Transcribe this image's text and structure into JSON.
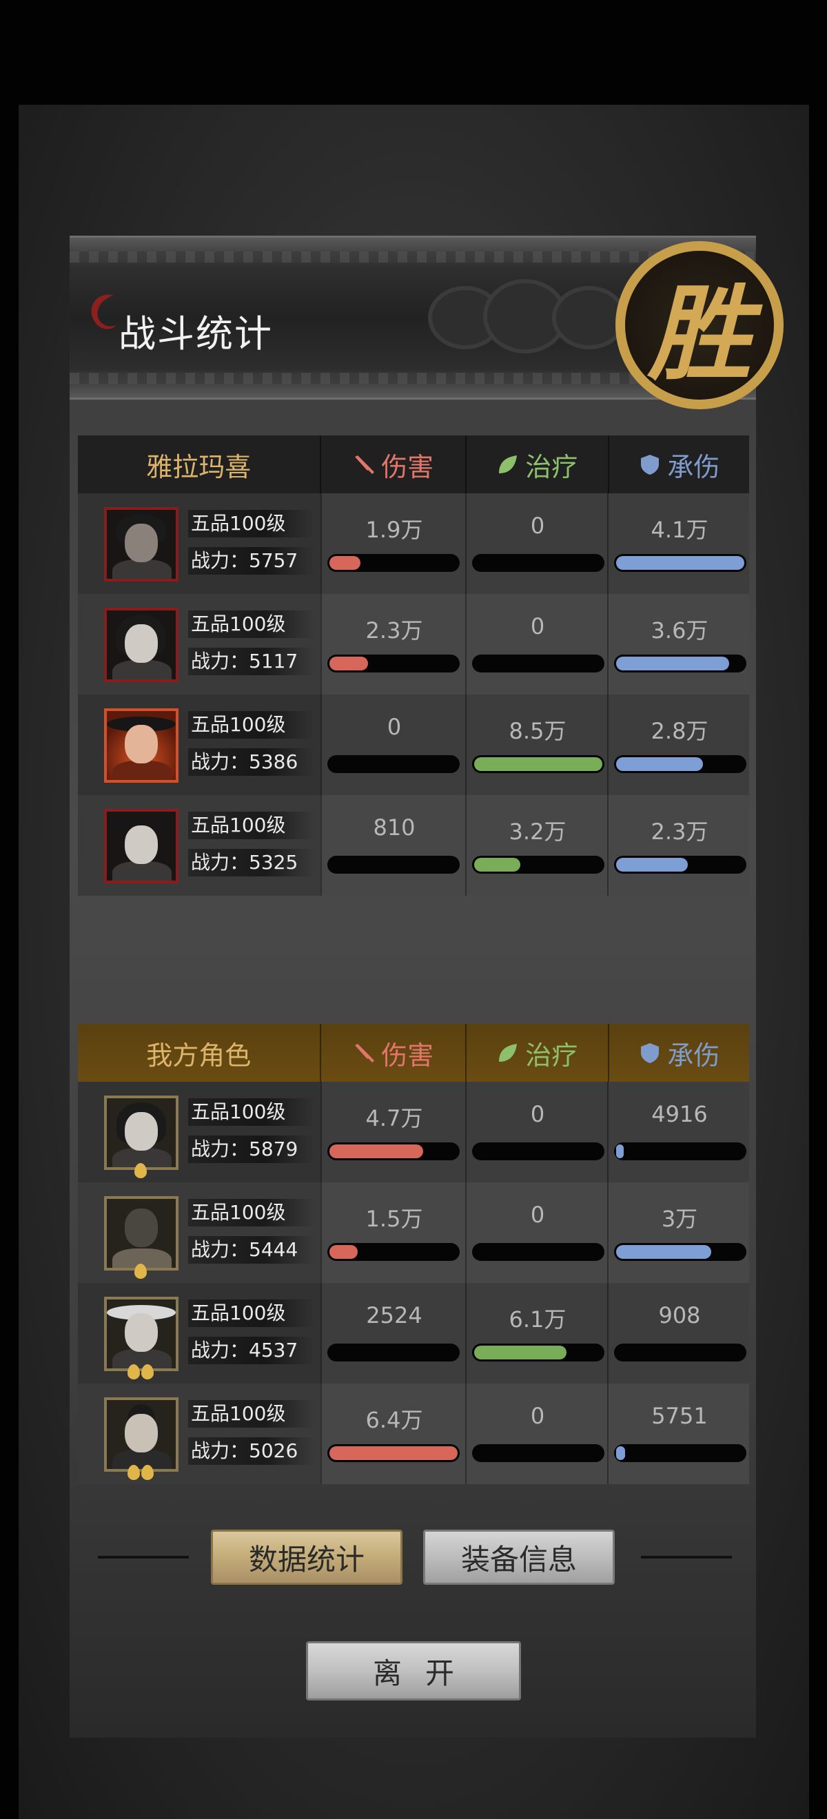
{
  "header": {
    "title": "战斗统计",
    "result_seal": "胜"
  },
  "columns": {
    "damage": "伤害",
    "healing": "治疗",
    "tanked": "承伤"
  },
  "enemy_team": {
    "name": "雅拉玛喜",
    "rows": [
      {
        "rank": "五品100级",
        "power": "战力：5757",
        "damage": "1.9万",
        "healing": "0",
        "tanked": "4.1万",
        "damage_fill": 0.24,
        "healing_fill": 0,
        "tanked_fill": 1.0,
        "frame": "enemy"
      },
      {
        "rank": "五品100级",
        "power": "战力：5117",
        "damage": "2.3万",
        "healing": "0",
        "tanked": "3.6万",
        "damage_fill": 0.3,
        "healing_fill": 0,
        "tanked_fill": 0.88,
        "frame": "enemy"
      },
      {
        "rank": "五品100级",
        "power": "战力：5386",
        "damage": "0",
        "healing": "8.5万",
        "tanked": "2.8万",
        "damage_fill": 0,
        "healing_fill": 1.0,
        "tanked_fill": 0.68,
        "frame": "fire"
      },
      {
        "rank": "五品100级",
        "power": "战力：5325",
        "damage": "810",
        "healing": "3.2万",
        "tanked": "2.3万",
        "damage_fill": 0,
        "healing_fill": 0.36,
        "tanked_fill": 0.56,
        "frame": "enemy"
      }
    ]
  },
  "ally_team": {
    "name": "我方角色",
    "rows": [
      {
        "rank": "五品100级",
        "power": "战力：5879",
        "damage": "4.7万",
        "healing": "0",
        "tanked": "4916",
        "damage_fill": 0.73,
        "healing_fill": 0,
        "tanked_fill": 0.06,
        "flames": 1
      },
      {
        "rank": "五品100级",
        "power": "战力：5444",
        "damage": "1.5万",
        "healing": "0",
        "tanked": "3万",
        "damage_fill": 0.22,
        "healing_fill": 0,
        "tanked_fill": 0.74,
        "flames": 1
      },
      {
        "rank": "五品100级",
        "power": "战力：4537",
        "damage": "2524",
        "healing": "6.1万",
        "tanked": "908",
        "damage_fill": 0,
        "healing_fill": 0.72,
        "tanked_fill": 0,
        "flames": 2
      },
      {
        "rank": "五品100级",
        "power": "战力：5026",
        "damage": "6.4万",
        "healing": "0",
        "tanked": "5751",
        "damage_fill": 1.0,
        "healing_fill": 0,
        "tanked_fill": 0.07,
        "flames": 2
      }
    ]
  },
  "buttons": {
    "data_stats": "数据统计",
    "equip_info": "装备信息",
    "leave": "离开"
  },
  "colors": {
    "damage": "#d6675a",
    "healing": "#79ad57",
    "tanked": "#7d9fd6",
    "ally_header": "#6a4c12",
    "seal_gold": "#c79e4a"
  }
}
